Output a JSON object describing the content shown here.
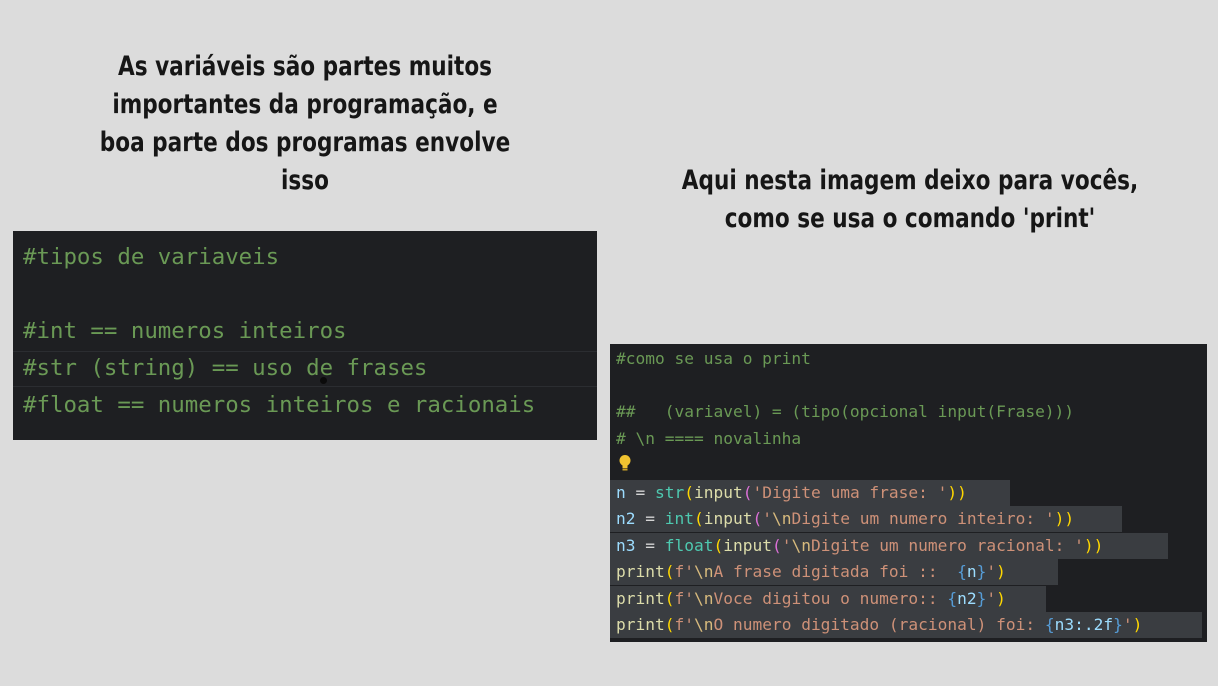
{
  "captions": {
    "left": [
      "As variáveis são partes muitos",
      "importantes da programação, e",
      "boa parte dos programas envolve",
      "isso"
    ],
    "right": [
      "Aqui nesta imagem deixo para vocês,",
      "como se usa o comando 'print'"
    ]
  },
  "left_code": {
    "lines": [
      "#tipos de variaveis",
      "",
      "#int == numeros inteiros",
      "#str (string) == uso de frases",
      "#float == numeros inteiros e racionais"
    ]
  },
  "right_code": {
    "comments": [
      "#como se usa o print",
      "",
      "##   (variavel) = (tipo(opcional input(Frase)))",
      "# \\n ==== novalinha"
    ],
    "lightbulb_icon": "lightbulb-icon",
    "code_lines": [
      {
        "var": "n",
        "op": " = ",
        "type": "str",
        "p1": "(",
        "fn": "input",
        "p2": "(",
        "str": "'Digite uma frase: '",
        "esc": "",
        "str2": "",
        "close": "))"
      },
      {
        "var": "n2",
        "op": " = ",
        "type": "int",
        "p1": "(",
        "fn": "input",
        "p2": "(",
        "str": "'",
        "esc": "\\n",
        "str2": "Digite um numero inteiro: '",
        "close": "))"
      },
      {
        "var": "n3",
        "op": " = ",
        "type": "float",
        "p1": "(",
        "fn": "input",
        "p2": "(",
        "str": "'",
        "esc": "\\n",
        "str2": "Digite um numero racional: '",
        "close": "))"
      }
    ],
    "print_lines": [
      {
        "fn": "print",
        "open": "(",
        "f": "f'",
        "esc": "\\n",
        "text": "A frase digitada foi ::  ",
        "b1": "{",
        "v": "n",
        "b2": "}",
        "end": "'",
        "close": ")"
      },
      {
        "fn": "print",
        "open": "(",
        "f": "f'",
        "esc": "\\n",
        "text": "Voce digitou o numero:: ",
        "b1": "{",
        "v": "n2",
        "b2": "}",
        "end": "'",
        "close": ")"
      },
      {
        "fn": "print",
        "open": "(",
        "f": "f'",
        "esc": "\\n",
        "text": "O numero digitado (racional) foi: ",
        "b1": "{",
        "v": "n3:.2f",
        "b2": "}",
        "end": "'",
        "close": ")"
      }
    ]
  },
  "colors": {
    "page_bg": "#dcdcdc",
    "editor_bg": "#1e1f22",
    "comment": "#6a9955",
    "selection": "#3a3d41"
  }
}
